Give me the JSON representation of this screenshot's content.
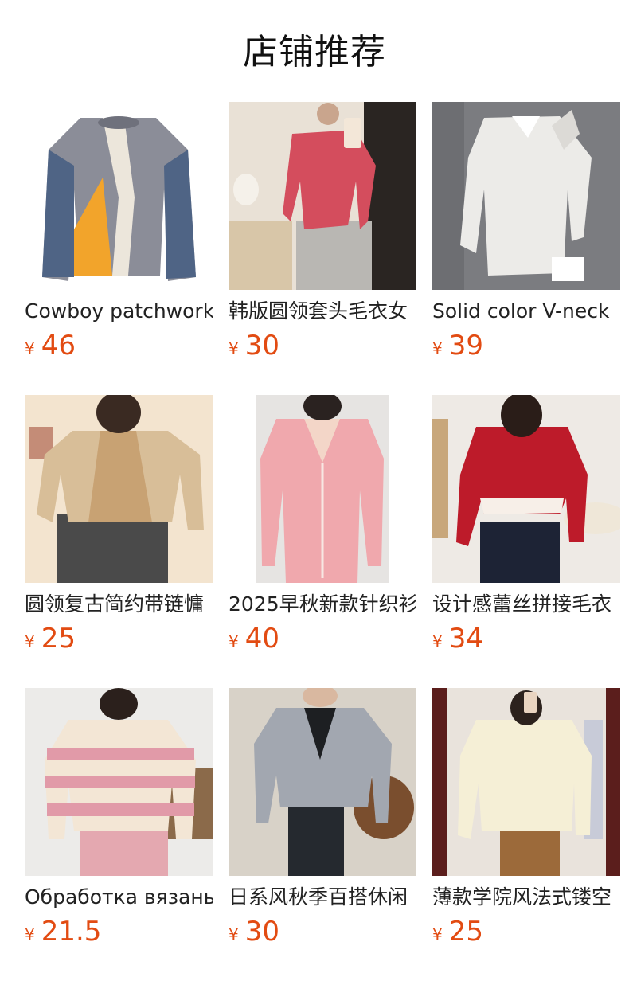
{
  "header": {
    "title": "店铺推荐"
  },
  "products": [
    {
      "name": "Cowboy patchwork",
      "currency": "¥",
      "price": "46",
      "image": "gray-blue-patchwork-sweater",
      "accent": "#8a8f9a"
    },
    {
      "name": "韩版圆领套头毛衣女",
      "currency": "¥",
      "price": "30",
      "image": "red-pullover-sweater",
      "accent": "#d4475a"
    },
    {
      "name": "Solid color V-neck",
      "currency": "¥",
      "price": "39",
      "image": "white-fuzzy-cardigan",
      "accent": "#e8e6e3"
    },
    {
      "name": "圆领复古简约带链慵",
      "currency": "¥",
      "price": "25",
      "image": "beige-ribbed-sweater",
      "accent": "#c7a57e"
    },
    {
      "name": "2025早秋新款针织衫",
      "currency": "¥",
      "price": "40",
      "image": "pink-vneck-cardigan",
      "accent": "#efa9ae"
    },
    {
      "name": "设计感蕾丝拼接毛衣",
      "currency": "¥",
      "price": "34",
      "image": "red-lace-cardigan",
      "accent": "#b81b27"
    },
    {
      "name": "Обработка вязань",
      "currency": "¥",
      "price": "21.5",
      "image": "pink-striped-cardigan",
      "accent": "#e7a6b2"
    },
    {
      "name": "日系风秋季百搭休闲",
      "currency": "¥",
      "price": "30",
      "image": "gray-vneck-cardigan",
      "accent": "#9aa0aa"
    },
    {
      "name": "薄款学院风法式镂空",
      "currency": "¥",
      "price": "25",
      "image": "cream-pointelle-cardigan",
      "accent": "#f2ecd2"
    }
  ]
}
